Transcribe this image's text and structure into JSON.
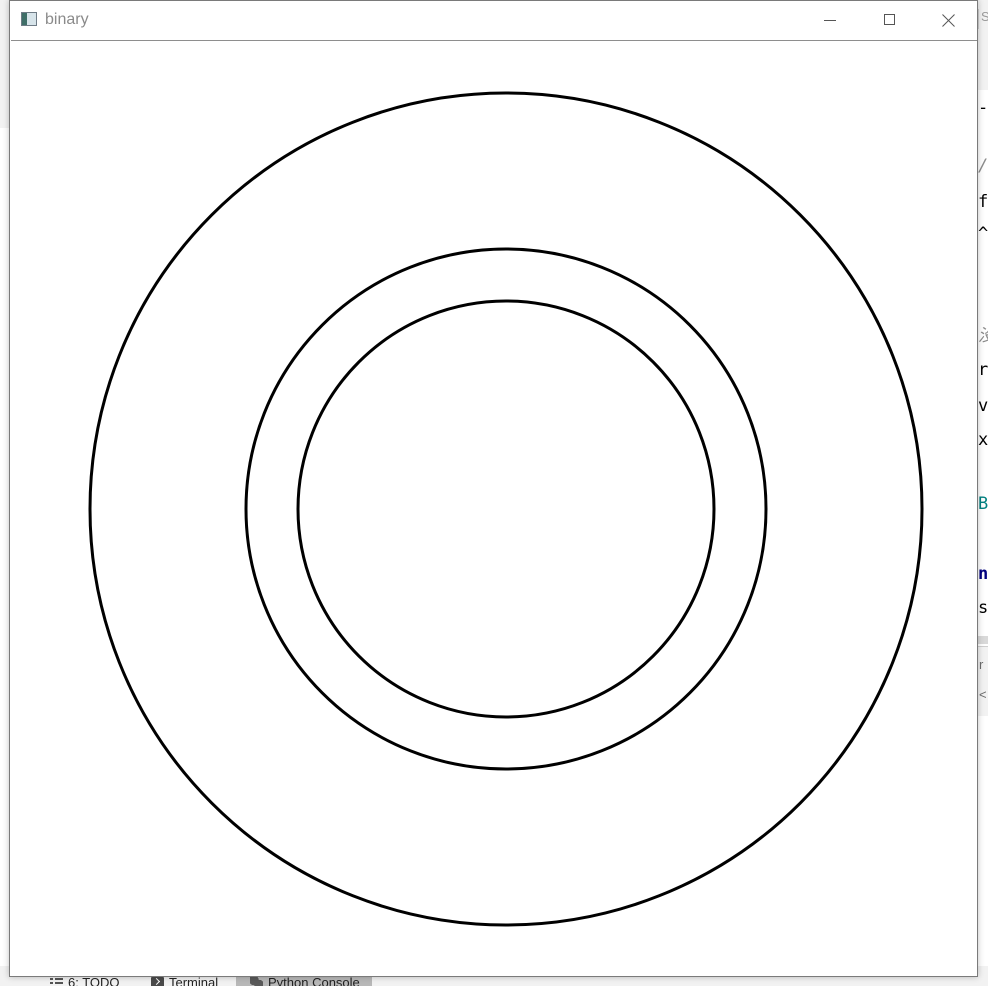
{
  "window": {
    "title": "binary",
    "controls": {
      "minimize": "minimize",
      "maximize": "maximize",
      "close": "close"
    }
  },
  "canvas": {
    "background": "#ffffff",
    "stroke_color": "#000000",
    "shapes": [
      "outer-circle",
      "middle-circle",
      "inner-circle"
    ]
  },
  "background_ide": {
    "search_fragment": "S",
    "editor_fragments": [
      "-",
      "/i",
      "f",
      "^",
      "没",
      "r",
      "v",
      "x",
      "B",
      "n",
      "s"
    ],
    "panel_fragments": [
      "r",
      "<"
    ],
    "tool_tabs": [
      {
        "label": "6: TODO",
        "icon": "todo-list-icon"
      },
      {
        "label": "Terminal",
        "icon": "terminal-icon"
      },
      {
        "label": "Python Console",
        "icon": "python-console-icon"
      }
    ]
  }
}
